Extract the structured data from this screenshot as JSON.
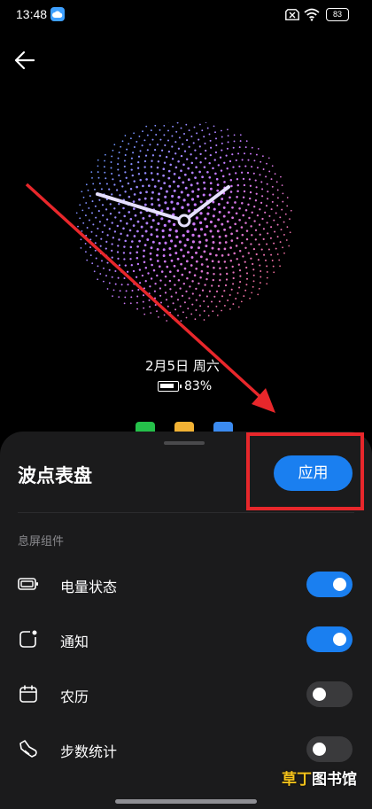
{
  "status_bar": {
    "time": "13:48",
    "battery": "83",
    "icons": [
      "cloud-icon",
      "sim-off-icon",
      "wifi-icon",
      "battery-icon"
    ]
  },
  "header": {
    "back_icon": "arrow-left-icon"
  },
  "preview": {
    "date": "2月5日 周六",
    "battery_percent": "83%",
    "colors": {
      "dots_cool": "#4aa3ff",
      "dots_warm": "#ff6a6a",
      "hands": "#e6e0ff"
    },
    "app_shortcuts": [
      "phone-icon",
      "notes-icon",
      "mail-icon"
    ]
  },
  "sheet": {
    "title": "波点表盘",
    "apply_label": "应用",
    "section_label": "息屏组件",
    "settings": [
      {
        "label": "电量状态",
        "icon": "battery-icon",
        "enabled": true
      },
      {
        "label": "通知",
        "icon": "notification-icon",
        "enabled": true
      },
      {
        "label": "农历",
        "icon": "calendar-icon",
        "enabled": false
      },
      {
        "label": "步数统计",
        "icon": "shoe-icon",
        "enabled": false
      }
    ]
  },
  "watermark": {
    "text_a": "草丁",
    "text_b": "图书馆"
  },
  "colors": {
    "accent": "#1a7ff0",
    "annotation": "#e8272b",
    "sheet_bg": "#1b1b1c"
  }
}
